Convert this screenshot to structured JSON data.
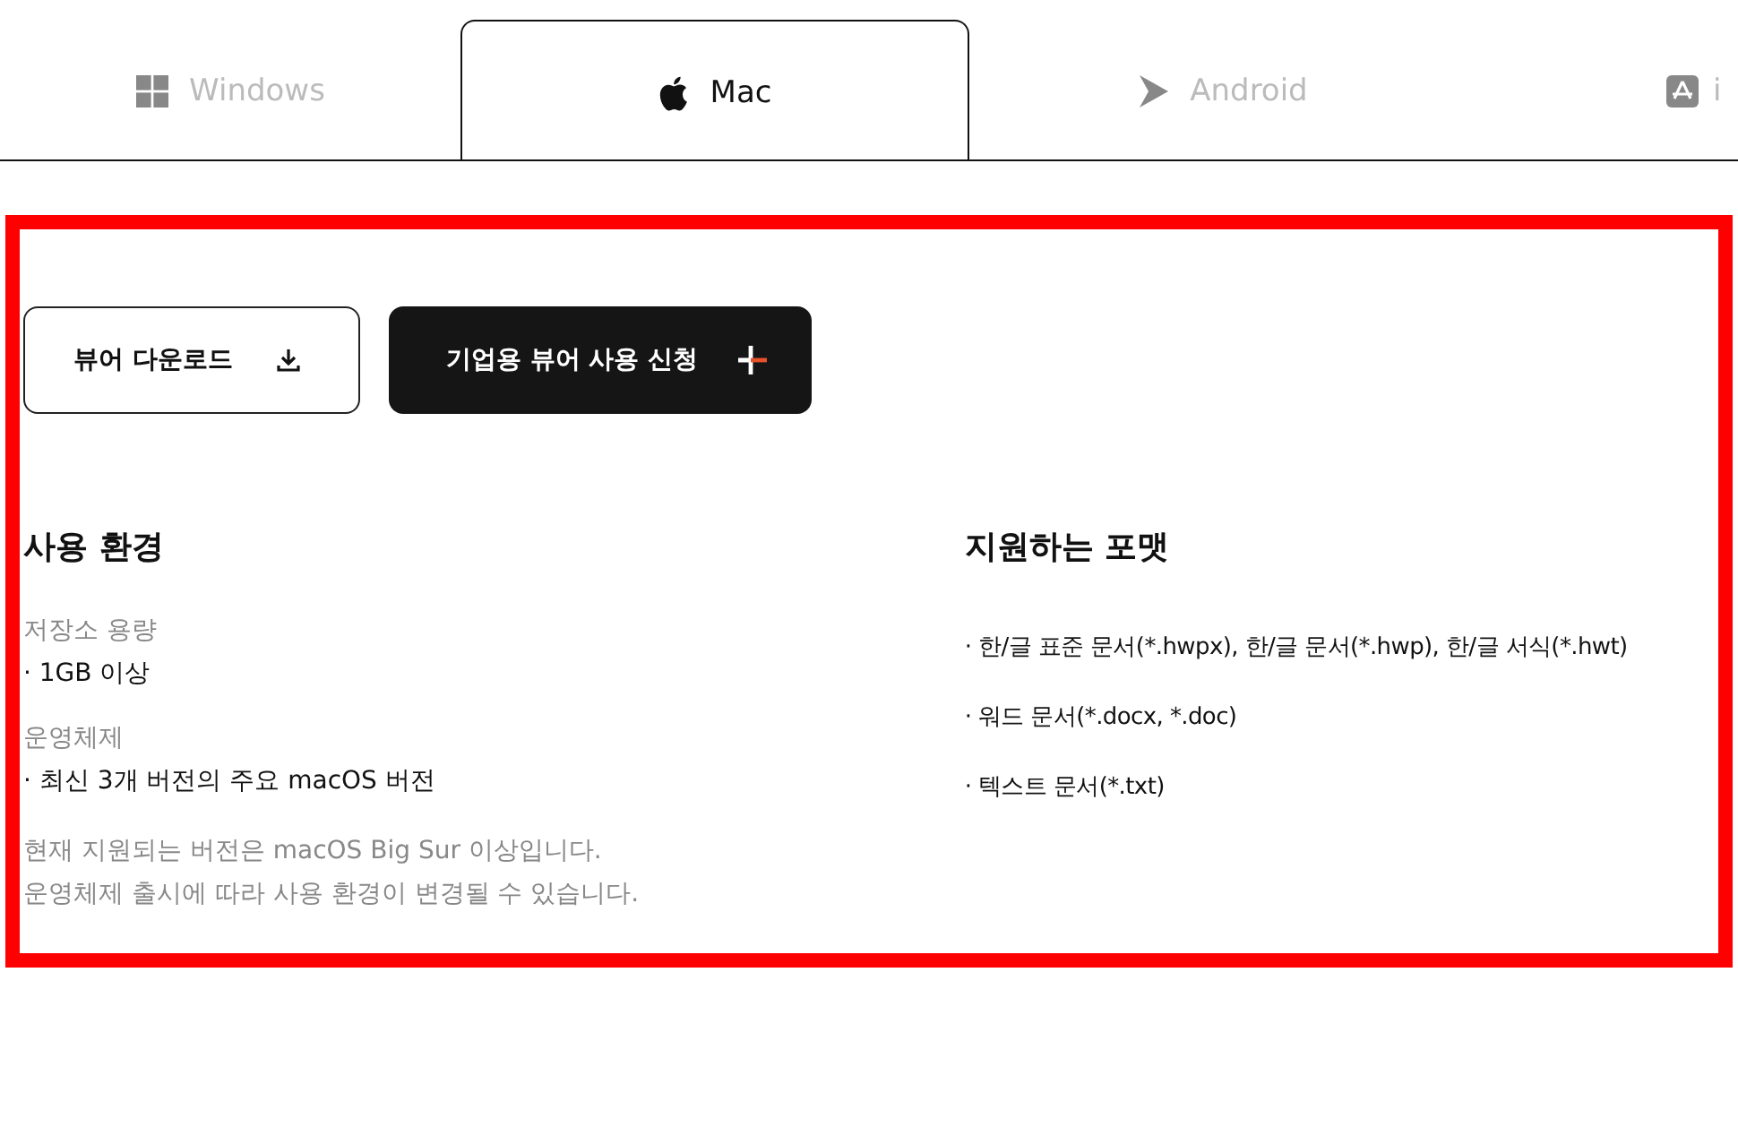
{
  "tabs": [
    {
      "label": "Windows",
      "kind": "windows",
      "selected": false
    },
    {
      "label": "Mac",
      "kind": "apple",
      "selected": true
    },
    {
      "label": "Android",
      "kind": "play",
      "selected": false
    },
    {
      "label": "i",
      "kind": "appstore",
      "selected": false
    }
  ],
  "buttons": [
    {
      "label": "뷰어 다운로드",
      "kind": "outline"
    },
    {
      "label": "기업용 뷰어 사용 신청",
      "kind": "filled"
    }
  ],
  "requirements": {
    "title": "사용 환경",
    "groups": [
      {
        "label": "저장소 용량",
        "items": [
          "· 1GB 이상"
        ]
      },
      {
        "label": "운영체제",
        "items": [
          "· 최신 3개 버전의 주요 macOS 버전"
        ]
      }
    ],
    "notes": [
      "현재 지원되는 버전은 macOS Big Sur 이상입니다.",
      "운영체제 출시에 따라 사용 환경이 변경될 수 있습니다."
    ]
  },
  "formats": {
    "title": "지원하는 포맷",
    "items": [
      "· 한/글 표준 문서(*.hwpx), 한/글 문서(*.hwp), 한/글 서식(*.hwt)",
      "· 워드 문서(*.docx, *.doc)",
      "· 텍스트 문서(*.txt)"
    ]
  },
  "highlight": {
    "color": "#ff0000"
  }
}
